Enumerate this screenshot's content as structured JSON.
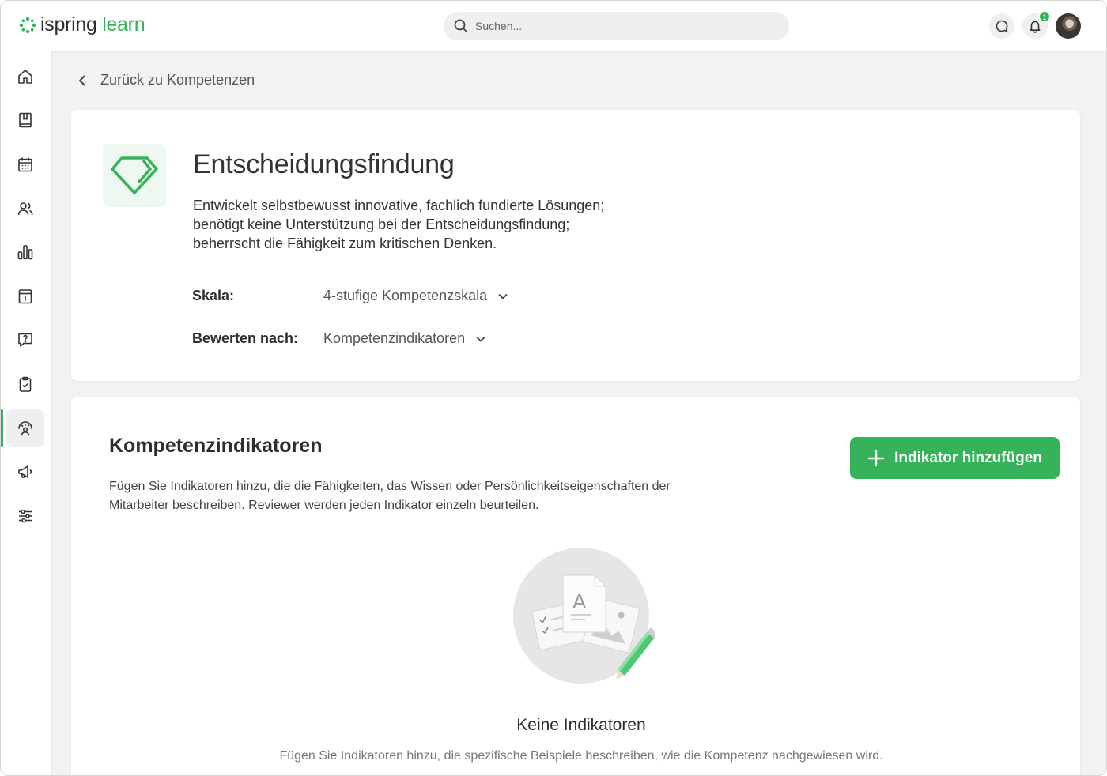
{
  "app": {
    "logo_part1": "ispring",
    "logo_part2": "learn",
    "brand_color": "#36b35a"
  },
  "search": {
    "placeholder": "Suchen..."
  },
  "header": {
    "notification_count": "1"
  },
  "sidebar": {
    "items": [
      {
        "icon": "home-icon"
      },
      {
        "icon": "book-icon"
      },
      {
        "icon": "calendar-icon"
      },
      {
        "icon": "users-icon"
      },
      {
        "icon": "bar-chart-icon"
      },
      {
        "icon": "info-calendar-icon"
      },
      {
        "icon": "question-chat-icon"
      },
      {
        "icon": "clipboard-check-icon"
      },
      {
        "icon": "competency-icon",
        "active": true
      },
      {
        "icon": "megaphone-icon"
      },
      {
        "icon": "settings-sliders-icon"
      }
    ]
  },
  "breadcrumb": {
    "back_label": "Zurück zu Kompetenzen"
  },
  "competency": {
    "title": "Entscheidungsfindung",
    "description_lines": [
      "Entwickelt selbstbewusst innovative, fachlich fundierte Lösungen;",
      "benötigt keine Unterstützung bei der Entscheidungsfindung;",
      "beherrscht die Fähigkeit zum kritischen Denken."
    ],
    "scale_label": "Skala:",
    "scale_value": "4-stufige Kompetenzskala",
    "rate_by_label": "Bewerten nach:",
    "rate_by_value": "Kompetenzindikatoren"
  },
  "indicators": {
    "title": "Kompetenzindikatoren",
    "description_lines": [
      "Fügen Sie Indikatoren hinzu, die die Fähigkeiten, das Wissen oder Persönlichkeitseigenschaften der",
      "Mitarbeiter beschreiben. Reviewer werden jeden Indikator einzeln beurteilen."
    ],
    "add_button_label": "Indikator hinzufügen",
    "empty_title": "Keine Indikatoren",
    "empty_description": "Fügen Sie Indikatoren hinzu, die spezifische Beispiele beschreiben, wie die Kompetenz nachgewiesen wird."
  }
}
